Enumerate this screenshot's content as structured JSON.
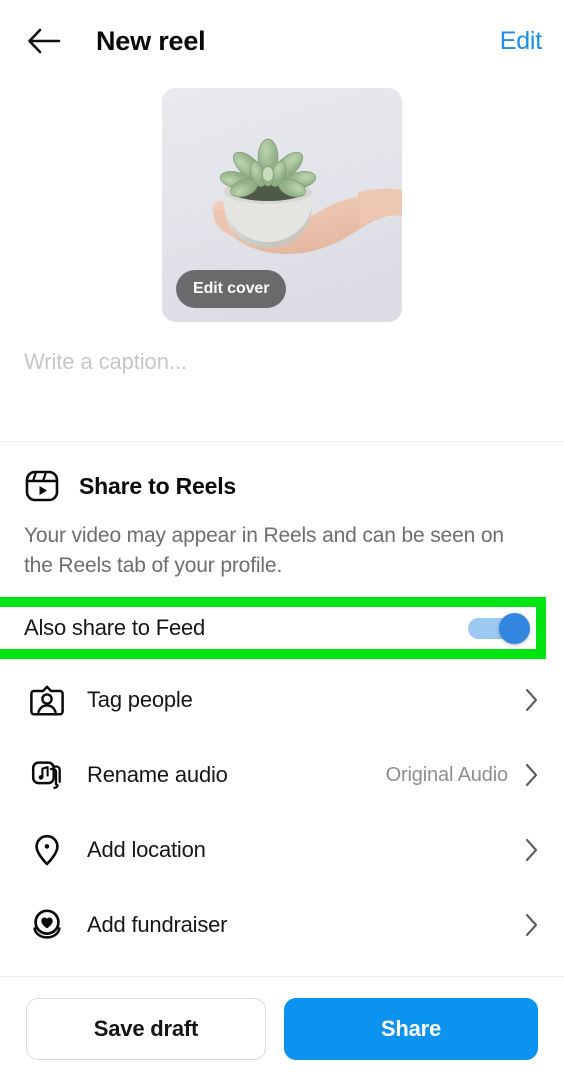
{
  "header": {
    "back_icon": "arrow-left-icon",
    "title": "New reel",
    "edit_label": "Edit",
    "edit_color": "#1a8cea"
  },
  "thumbnail": {
    "alt": "hand holding a small grey pot with a green succulent",
    "edit_cover_label": "Edit cover"
  },
  "caption": {
    "placeholder": "Write a caption...",
    "value": ""
  },
  "reels": {
    "icon": "reels-icon",
    "title": "Share to Reels",
    "description": "Your video may appear in Reels and can be seen on the Reels tab of your profile."
  },
  "toggle_row": {
    "label": "Also share to Feed",
    "state": "on",
    "highlight_color": "#00e512",
    "track_color": "#9dc8f2",
    "knob_color": "#3386e0"
  },
  "options": [
    {
      "icon": "tag-people-icon",
      "label": "Tag people",
      "value": ""
    },
    {
      "icon": "music-note-icon",
      "label": "Rename audio",
      "value": "Original Audio"
    },
    {
      "icon": "location-pin-icon",
      "label": "Add location",
      "value": ""
    },
    {
      "icon": "fundraiser-heart-icon",
      "label": "Add fundraiser",
      "value": ""
    }
  ],
  "footer": {
    "save_draft_label": "Save draft",
    "share_label": "Share",
    "share_color": "#0b93ef"
  }
}
